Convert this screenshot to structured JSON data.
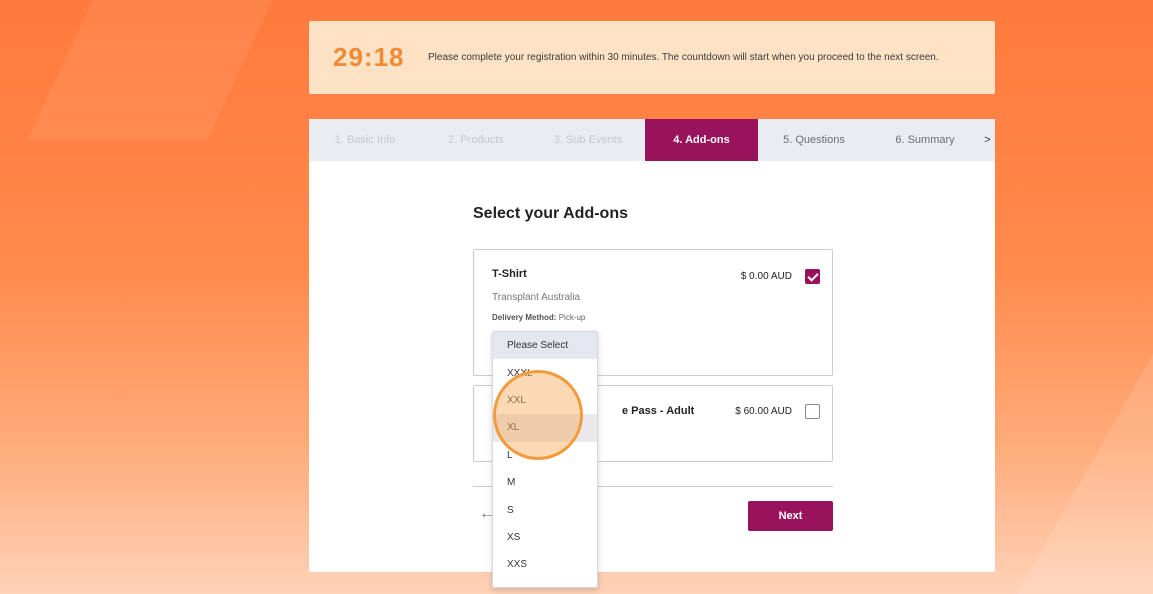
{
  "timer": {
    "value": "29:18",
    "message": "Please complete your registration within 30 minutes. The countdown will start when you proceed to the next screen."
  },
  "steps": [
    {
      "label": "1. Basic Info",
      "state": "done"
    },
    {
      "label": "2. Products",
      "state": "done"
    },
    {
      "label": "3. Sub Events",
      "state": "done"
    },
    {
      "label": "4. Add-ons",
      "state": "active"
    },
    {
      "label": "5. Questions",
      "state": "upcoming"
    },
    {
      "label": "6. Summary",
      "state": "upcoming"
    }
  ],
  "steps_more": ">",
  "section_title": "Select your Add-ons",
  "addons": [
    {
      "name": "T-Shirt",
      "org": "Transplant Australia",
      "delivery_label": "Delivery Method:",
      "delivery_value": "Pick-up",
      "price": "$ 0.00 AUD",
      "checked": true
    },
    {
      "name": "e Pass - Adult",
      "price": "$ 60.00 AUD",
      "checked": false
    }
  ],
  "dropdown": {
    "options": [
      "Please Select",
      "XXXL",
      "XXL",
      "XL",
      "L",
      "M",
      "S",
      "XS",
      "XXS"
    ],
    "selected": "Please Select",
    "hovered": "XL"
  },
  "nav": {
    "back_icon": "arrow-left-icon",
    "next_label": "Next"
  },
  "colors": {
    "accent": "#98125c",
    "timer": "#f08a34",
    "banner_bg": "#fde2c6"
  }
}
